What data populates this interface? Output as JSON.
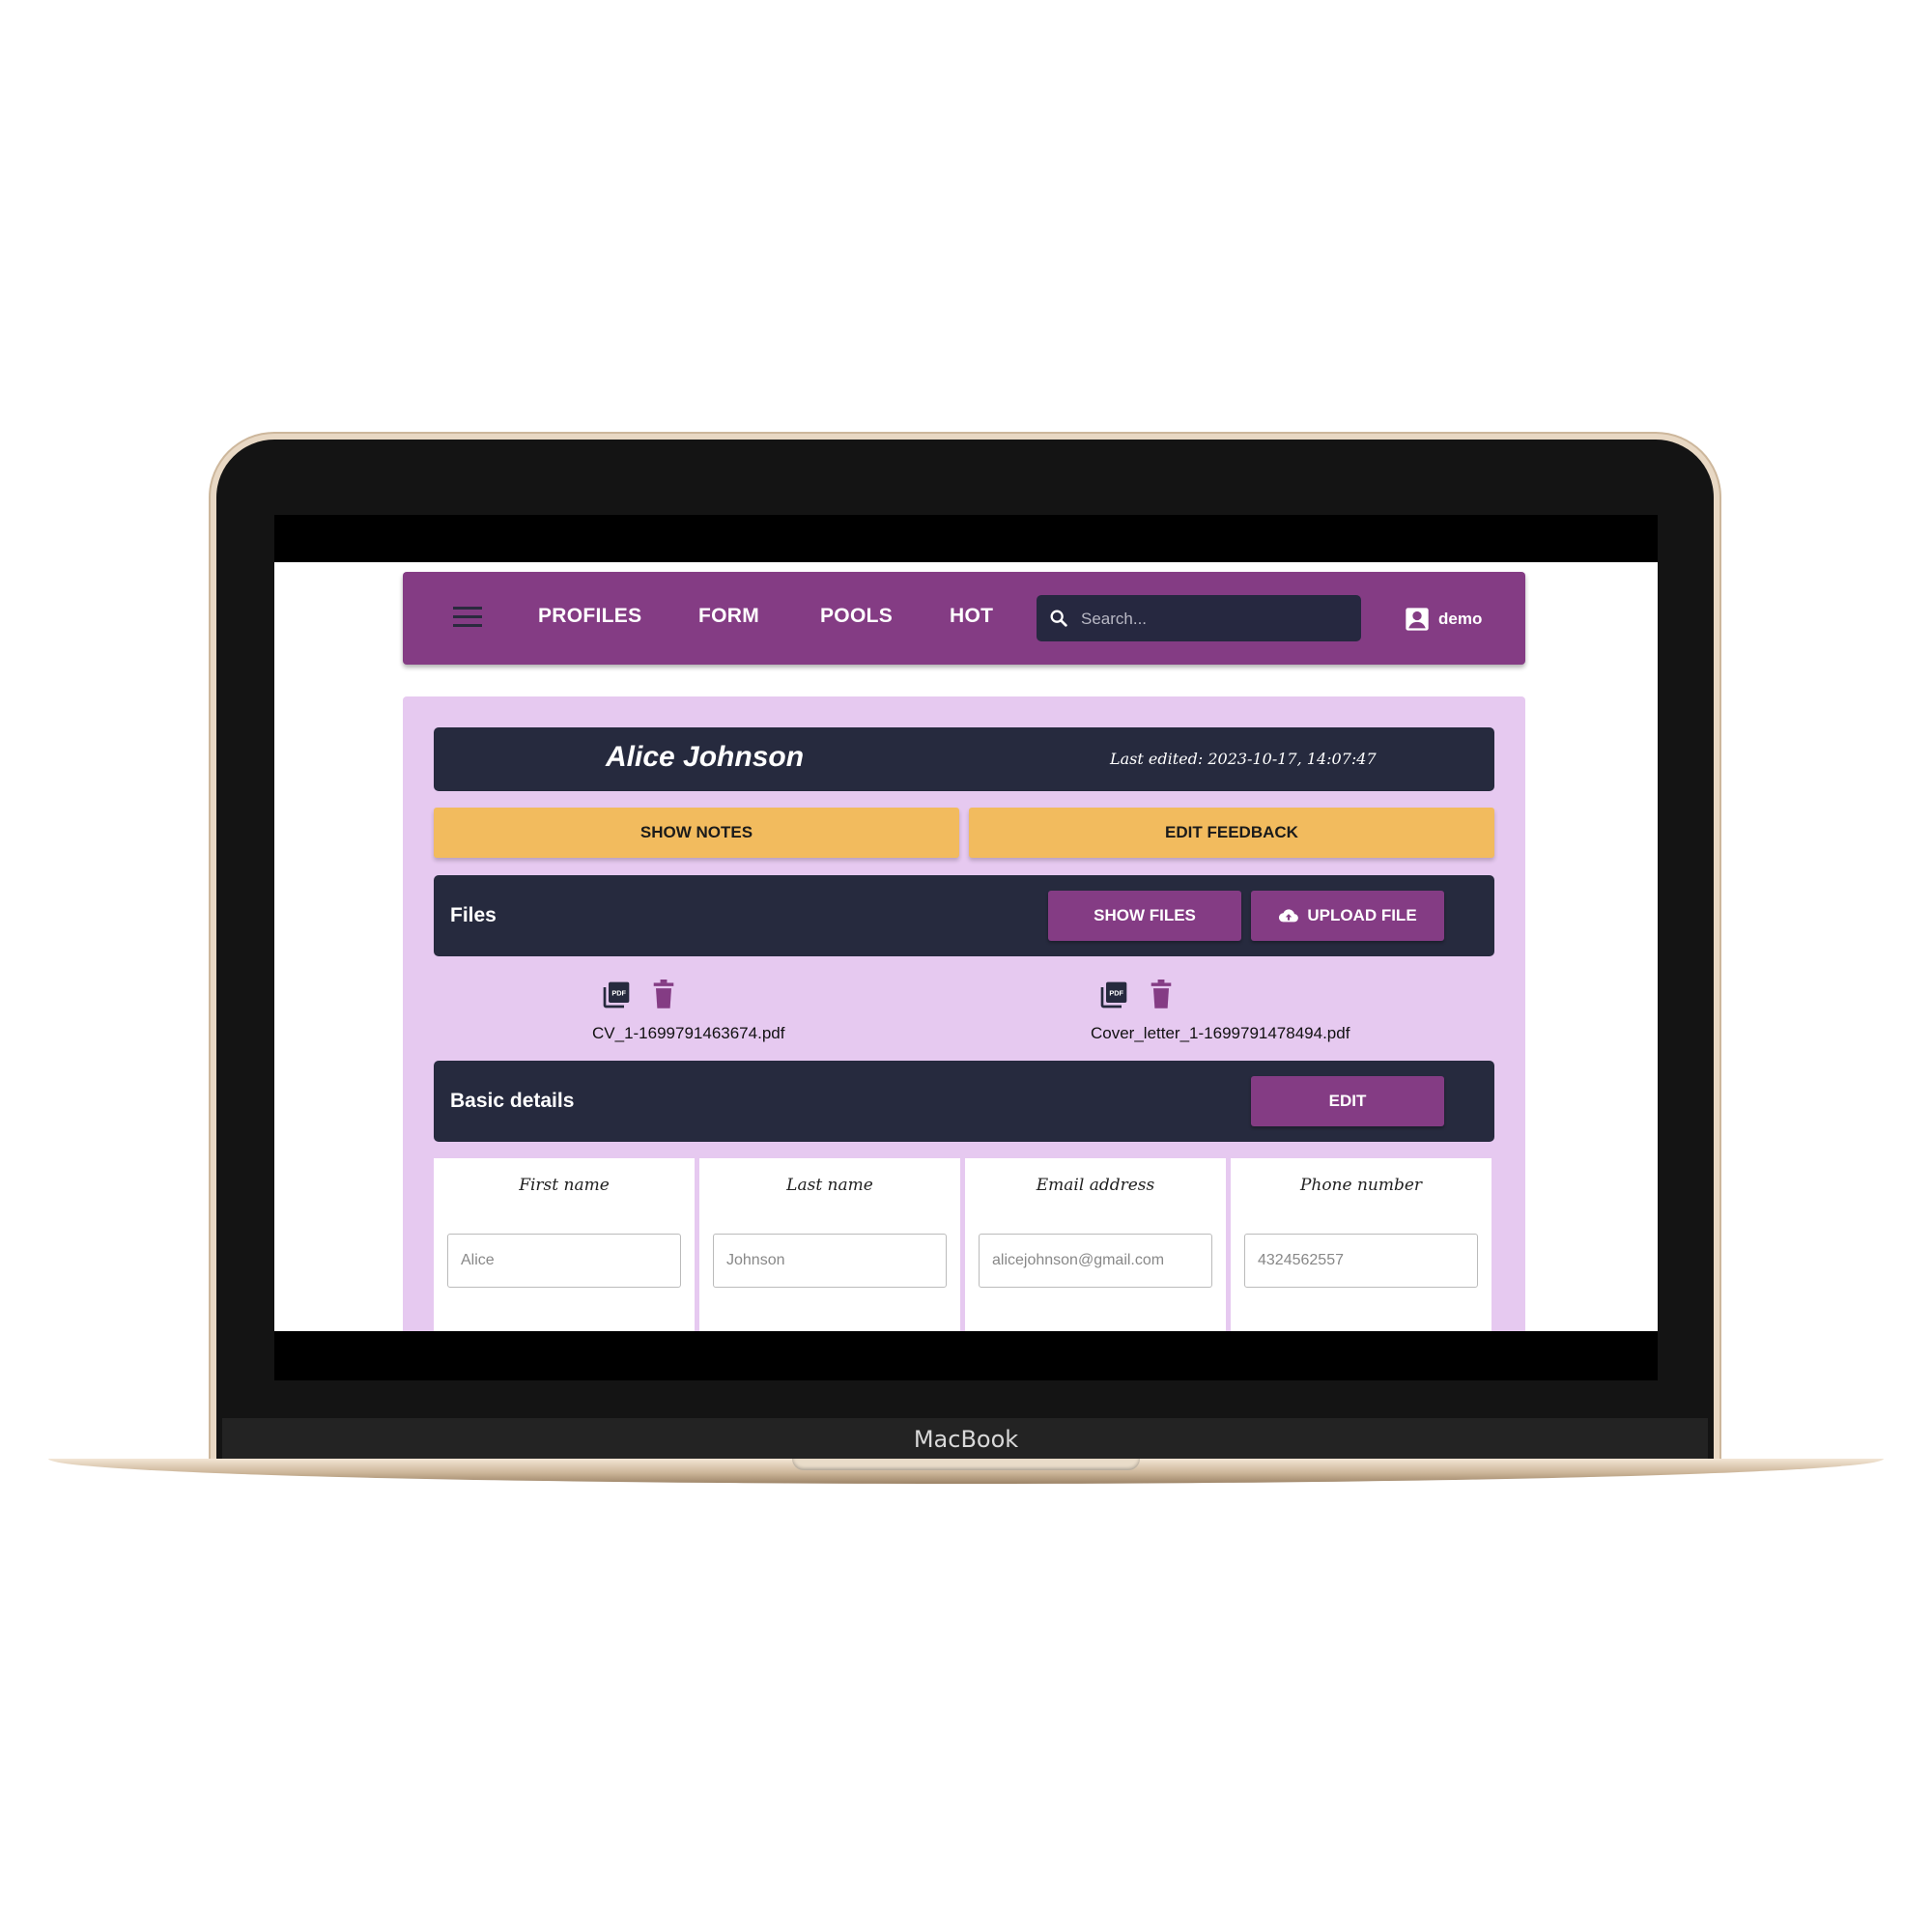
{
  "device": {
    "brand": "MacBook"
  },
  "nav": {
    "items": [
      "PROFILES",
      "FORM",
      "POOLS",
      "HOT"
    ],
    "search_placeholder": "Search...",
    "username": "demo"
  },
  "profile": {
    "name": "Alice Johnson",
    "last_edited": "Last edited: 2023-10-17, 14:07:47"
  },
  "actions": {
    "show_notes": "SHOW NOTES",
    "edit_feedback": "EDIT FEEDBACK"
  },
  "files": {
    "title": "Files",
    "show_files": "SHOW FILES",
    "upload_file": "UPLOAD FILE",
    "items": [
      "CV_1-1699791463674.pdf",
      "Cover_letter_1-1699791478494.pdf"
    ]
  },
  "basic_details": {
    "title": "Basic details",
    "edit": "EDIT",
    "fields": [
      {
        "label": "First name",
        "placeholder": "Alice"
      },
      {
        "label": "Last name",
        "placeholder": "Johnson"
      },
      {
        "label": "Email address",
        "placeholder": "alicejohnson@gmail.com"
      },
      {
        "label": "Phone number",
        "placeholder": "4324562557"
      }
    ]
  },
  "colors": {
    "primary": "#843c84",
    "dark": "#262a3e",
    "accent": "#f2bb5e",
    "panel": "#e6c9f0"
  }
}
